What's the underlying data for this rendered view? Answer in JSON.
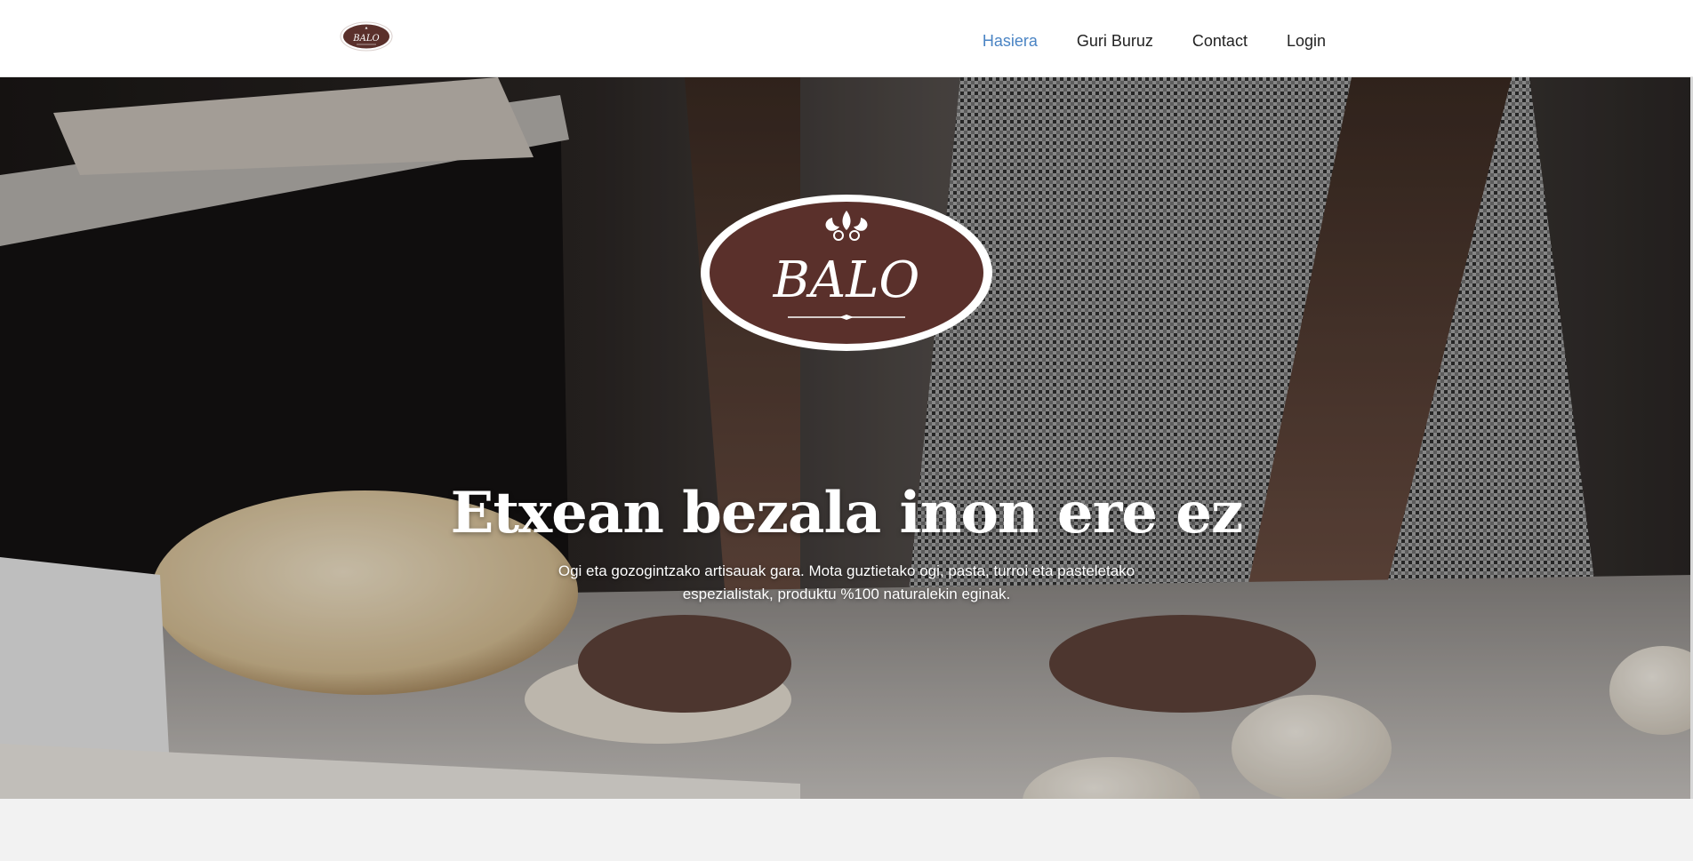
{
  "brand": {
    "logo_text": "BALO",
    "color_primary": "#5a302b",
    "color_outline": "#ffffff"
  },
  "nav": {
    "items": [
      {
        "label": "Hasiera",
        "active": true
      },
      {
        "label": "Guri Buruz",
        "active": false
      },
      {
        "label": "Contact",
        "active": false
      },
      {
        "label": "Login",
        "active": false
      }
    ],
    "active_color": "#4a84c4",
    "text_color": "#222222"
  },
  "hero": {
    "title": "Etxean bezala inon ere ez",
    "subtitle": "Ogi eta gozogintzako artisauak gara. Mota guztietako ogi, pasta, turroi eta pasteletako espezialistak, produktu %100 naturalekin eginak."
  }
}
